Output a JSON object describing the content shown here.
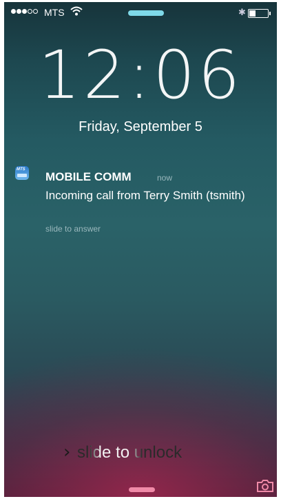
{
  "status_bar": {
    "carrier": "MTS",
    "signal_bars_filled": 3,
    "signal_bars_total": 5,
    "battery_fraction": 0.3
  },
  "lock": {
    "time": "12:06",
    "date": "Friday, September 5"
  },
  "notification": {
    "app_name": "MOBILE COMM",
    "icon_label": "MTS",
    "timestamp": "now",
    "message": "Incoming call from Terry Smith (tsmith)",
    "action_hint": "slide to answer"
  },
  "bottom": {
    "slider_text": "slide to unlock"
  },
  "colors": {
    "top_pill": "#7fd9e8",
    "bottom_pill": "#f08aa8",
    "camera_icon": "#f08aa8"
  },
  "icons": [
    "signal-dots",
    "wifi-icon",
    "bluetooth-icon",
    "battery-icon",
    "chevron-right-icon",
    "camera-icon",
    "app-icon"
  ]
}
